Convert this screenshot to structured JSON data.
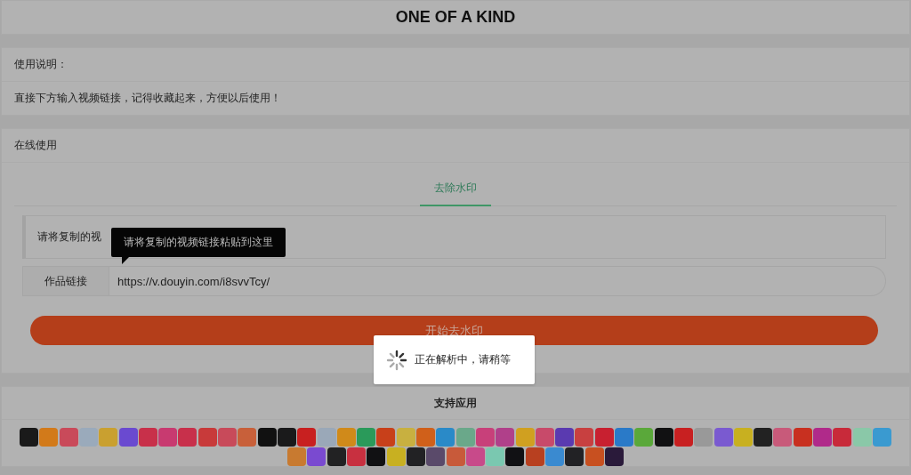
{
  "header": {
    "title": "ONE OF A KIND"
  },
  "instructions": {
    "heading": "使用说明：",
    "body": "直接下方输入视频链接，记得收藏起来，方便以后使用！"
  },
  "online": {
    "heading": "在线使用",
    "tabs": [
      {
        "label": "去除水印",
        "selected": true
      }
    ],
    "notice": "请将复制的视",
    "tooltip": "请将复制的视频链接粘贴到这里",
    "input": {
      "label": "作品链接",
      "value": "https://v.douyin.com/i8svvTcy/"
    },
    "submit": "开始去水印"
  },
  "loading": {
    "message": "正在解析中，请稍等"
  },
  "apps": {
    "heading": "支持应用",
    "icons": [
      {
        "color": "#1a1a1a"
      },
      {
        "color": "#d27a1a"
      },
      {
        "color": "#c94a5a"
      },
      {
        "color": "#9aaabb"
      },
      {
        "color": "#c9a030"
      },
      {
        "color": "#6a4ad0"
      },
      {
        "color": "#c8304a"
      },
      {
        "color": "#c83a70"
      },
      {
        "color": "#c8304b"
      },
      {
        "color": "#c83a3a"
      },
      {
        "color": "#c84a5a"
      },
      {
        "color": "#c8603a"
      },
      {
        "color": "#111111"
      },
      {
        "color": "#1a1a1b"
      },
      {
        "color": "#c82020"
      },
      {
        "color": "#9aa8b8"
      },
      {
        "color": "#d08a1a"
      },
      {
        "color": "#2a9a5a"
      },
      {
        "color": "#c8401a"
      },
      {
        "color": "#c8b040"
      },
      {
        "color": "#d0601a"
      },
      {
        "color": "#2a8ac8"
      },
      {
        "color": "#6aa88a"
      },
      {
        "color": "#c8407a"
      },
      {
        "color": "#b0408a"
      },
      {
        "color": "#d0a020"
      },
      {
        "color": "#c84a6a"
      },
      {
        "color": "#5a3ab0"
      },
      {
        "color": "#c84040"
      },
      {
        "color": "#c82030"
      },
      {
        "color": "#2a7ac8"
      },
      {
        "color": "#5aa83a"
      },
      {
        "color": "#111112"
      },
      {
        "color": "#c82021"
      },
      {
        "color": "#999999"
      },
      {
        "color": "#7a5ad0"
      },
      {
        "color": "#c8b020"
      },
      {
        "color": "#222222"
      },
      {
        "color": "#c85a7a"
      },
      {
        "color": "#c83020"
      },
      {
        "color": "#b02a8a"
      },
      {
        "color": "#c82a3a"
      },
      {
        "color": "#8ac8a8"
      },
      {
        "color": "#3a9ad0"
      },
      {
        "color": "#c87a30"
      },
      {
        "color": "#7a4ad0"
      },
      {
        "color": "#222223"
      },
      {
        "color": "#c83040"
      },
      {
        "color": "#111113"
      },
      {
        "color": "#c8b021"
      },
      {
        "color": "#222224"
      },
      {
        "color": "#5a4a6a"
      },
      {
        "color": "#c85a3a"
      },
      {
        "color": "#c84a8a"
      },
      {
        "color": "#7ac8b0"
      },
      {
        "color": "#111114"
      },
      {
        "color": "#b84020"
      },
      {
        "color": "#3a8ad0"
      },
      {
        "color": "#222225"
      },
      {
        "color": "#c85020"
      },
      {
        "color": "#2a1a3a"
      }
    ]
  }
}
